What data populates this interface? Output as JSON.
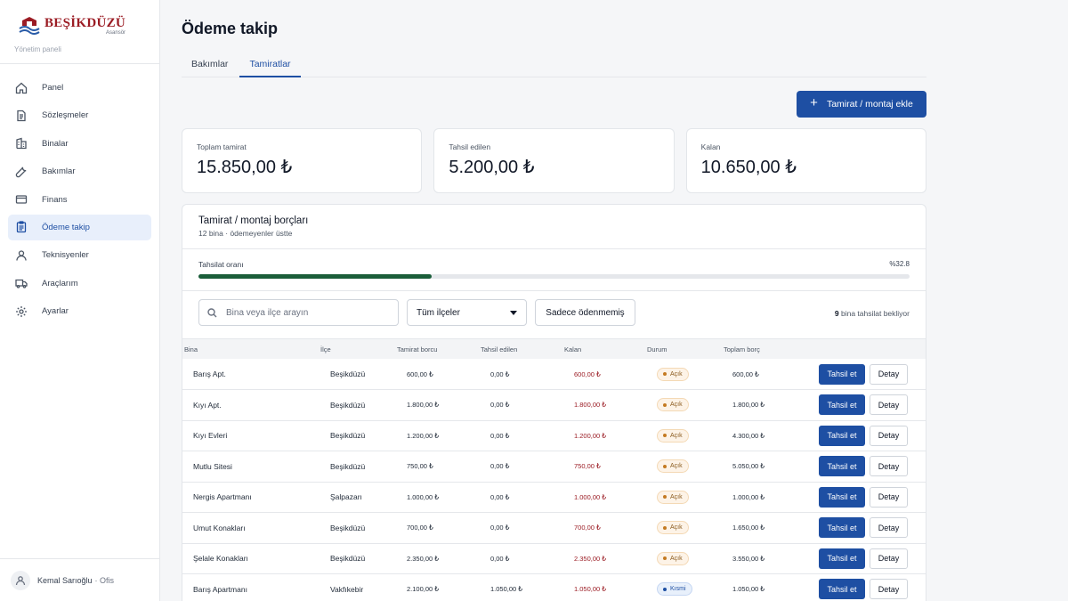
{
  "brand": {
    "name": "BEŞİKDÜZÜ",
    "sub": "Asansör",
    "caption": "Yönetim paneli",
    "colors": {
      "primary": "#9b1c24",
      "wave": "#2a5ca8"
    }
  },
  "nav": [
    {
      "label": "Panel",
      "icon": "home-icon"
    },
    {
      "label": "Sözleşmeler",
      "icon": "document-icon"
    },
    {
      "label": "Binalar",
      "icon": "building-icon"
    },
    {
      "label": "Bakımlar",
      "icon": "wrench-icon"
    },
    {
      "label": "Finans",
      "icon": "credit-card-icon"
    },
    {
      "label": "Ödeme takip",
      "icon": "clipboard-icon",
      "active": true
    },
    {
      "label": "Teknisyenler",
      "icon": "person-icon"
    },
    {
      "label": "Araçlarım",
      "icon": "truck-icon"
    },
    {
      "label": "Ayarlar",
      "icon": "gear-icon"
    }
  ],
  "user": {
    "name": "Kemal Sarıoğlu",
    "role": "· Ofis"
  },
  "page": {
    "title": "Ödeme takip"
  },
  "tabs": [
    {
      "label": "Bakımlar"
    },
    {
      "label": "Tamiratlar",
      "active": true
    }
  ],
  "add_button": {
    "label": "Tamirat / montaj ekle"
  },
  "stats": [
    {
      "label": "Toplam tamirat",
      "value": "15.850,00 ₺"
    },
    {
      "label": "Tahsil edilen",
      "value": "5.200,00 ₺"
    },
    {
      "label": "Kalan",
      "value": "10.650,00 ₺"
    }
  ],
  "panel": {
    "title": "Tamirat / montaj borçları",
    "subtitle": "12 bina  · ödemeyenler üstte"
  },
  "progress": {
    "label": "Tahsilat oranı",
    "percent_text": "%32.8",
    "fraction": 0.328,
    "color": "#1b5e3a"
  },
  "filters": {
    "search_placeholder": "Bina veya ilçe arayın",
    "district_select": "Tüm ilçeler",
    "unpaid_only": "Sadece ödenmemiş",
    "waiting_count": "9",
    "waiting_text": " bina tahsilat bekliyor"
  },
  "table": {
    "headers": [
      "Bina",
      "İlçe",
      "Tamirat borcu",
      "Tahsil edilen",
      "Kalan",
      "Durum",
      "Toplam borç",
      ""
    ],
    "collect_label": "Tahsil et",
    "detail_label": "Detay",
    "rows": [
      {
        "bina": "Barış Apt.",
        "ilce": "Beşikdüzü",
        "borc": "600,00 ₺",
        "tahsil": "0,00 ₺",
        "kalan": "600,00 ₺",
        "durum": "Açık",
        "status": "open",
        "toplam": "600,00 ₺"
      },
      {
        "bina": "Kıyı Apt.",
        "ilce": "Beşikdüzü",
        "borc": "1.800,00 ₺",
        "tahsil": "0,00 ₺",
        "kalan": "1.800,00 ₺",
        "durum": "Açık",
        "status": "open",
        "toplam": "1.800,00 ₺"
      },
      {
        "bina": "Kıyı Evleri",
        "ilce": "Beşikdüzü",
        "borc": "1.200,00 ₺",
        "tahsil": "0,00 ₺",
        "kalan": "1.200,00 ₺",
        "durum": "Açık",
        "status": "open",
        "toplam": "4.300,00 ₺"
      },
      {
        "bina": "Mutlu Sitesi",
        "ilce": "Beşikdüzü",
        "borc": "750,00 ₺",
        "tahsil": "0,00 ₺",
        "kalan": "750,00 ₺",
        "durum": "Açık",
        "status": "open",
        "toplam": "5.050,00 ₺"
      },
      {
        "bina": "Nergis Apartmanı",
        "ilce": "Şalpazarı",
        "borc": "1.000,00 ₺",
        "tahsil": "0,00 ₺",
        "kalan": "1.000,00 ₺",
        "durum": "Açık",
        "status": "open",
        "toplam": "1.000,00 ₺"
      },
      {
        "bina": "Umut Konakları",
        "ilce": "Beşikdüzü",
        "borc": "700,00 ₺",
        "tahsil": "0,00 ₺",
        "kalan": "700,00 ₺",
        "durum": "Açık",
        "status": "open",
        "toplam": "1.650,00 ₺"
      },
      {
        "bina": "Şelale Konakları",
        "ilce": "Beşikdüzü",
        "borc": "2.350,00 ₺",
        "tahsil": "0,00 ₺",
        "kalan": "2.350,00 ₺",
        "durum": "Açık",
        "status": "open",
        "toplam": "3.550,00 ₺"
      },
      {
        "bina": "Barış Apartmanı",
        "ilce": "Vakfıkebir",
        "borc": "2.100,00 ₺",
        "tahsil": "1.050,00 ₺",
        "kalan": "1.050,00 ₺",
        "durum": "Kısmi",
        "status": "partial",
        "toplam": "1.050,00 ₺"
      }
    ]
  }
}
